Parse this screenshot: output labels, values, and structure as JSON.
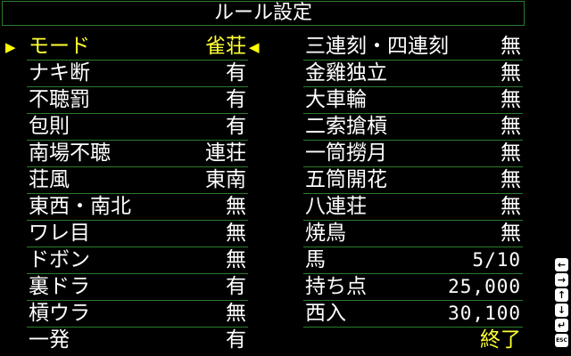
{
  "title": "ルール設定",
  "left_rows": [
    {
      "label": "モード",
      "value": "雀荘"
    },
    {
      "label": "ナキ断",
      "value": "有"
    },
    {
      "label": "不聴罰",
      "value": "有"
    },
    {
      "label": "包則",
      "value": "有"
    },
    {
      "label": "南場不聴",
      "value": "連荘"
    },
    {
      "label": "荘風",
      "value": "東南"
    },
    {
      "label": "東西・南北",
      "value": "無"
    },
    {
      "label": "ワレ目",
      "value": "無"
    },
    {
      "label": "ドボン",
      "value": "無"
    },
    {
      "label": "裏ドラ",
      "value": "有"
    },
    {
      "label": "槓ウラ",
      "value": "無"
    },
    {
      "label": "一発",
      "value": "有"
    }
  ],
  "right_rows": [
    {
      "label": "三連刻・四連刻",
      "value": "無"
    },
    {
      "label": "金雞独立",
      "value": "無"
    },
    {
      "label": "大車輪",
      "value": "無"
    },
    {
      "label": "二索搶槓",
      "value": "無"
    },
    {
      "label": "一筒撈月",
      "value": "無"
    },
    {
      "label": "五筒開花",
      "value": "無"
    },
    {
      "label": "八連荘",
      "value": "無"
    },
    {
      "label": "焼鳥",
      "value": "無"
    },
    {
      "label": "馬",
      "value": "5/10"
    },
    {
      "label": "持ち点",
      "value": "25,000"
    },
    {
      "label": "西入",
      "value": "30,100"
    },
    {
      "label": "",
      "value": "終了"
    }
  ],
  "cursor_glyph_left": "▶",
  "cursor_glyph_right": "◀",
  "key_icons": [
    {
      "icon": "arrow-left-icon",
      "glyph": "←"
    },
    {
      "icon": "arrow-right-icon",
      "glyph": "→"
    },
    {
      "icon": "arrow-up-icon",
      "glyph": "↑"
    },
    {
      "icon": "arrow-down-icon",
      "glyph": "↓"
    },
    {
      "icon": "return-icon",
      "glyph": "↵"
    },
    {
      "icon": "esc-key-icon",
      "glyph": "ESC"
    }
  ],
  "colors": {
    "background": "#000000",
    "text": "#ffffff",
    "highlight": "#ffff33",
    "divider": "#2c7a2c"
  }
}
